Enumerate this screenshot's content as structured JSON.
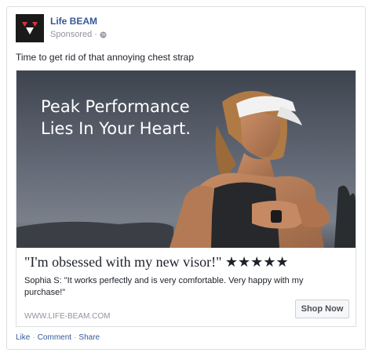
{
  "post": {
    "page_name": "Life BEAM",
    "sponsored": "Sponsored",
    "dot": "·",
    "text": "Time to get rid of that annoying chest strap"
  },
  "ad": {
    "headline_line1": "Peak Performance",
    "headline_line2": "Lies In Your Heart.",
    "quote": "\"I'm obsessed with my new visor!\" ★★★★★",
    "review": "Sophia S: \"It works perfectly and is very comfortable. Very happy with my purchase!\"",
    "url": "WWW.LIFE-BEAM.COM",
    "cta": "Shop Now"
  },
  "actions": {
    "like": "Like",
    "comment": "Comment",
    "share": "Share",
    "sep": "·"
  },
  "icons": {
    "logo": "life-beam-logo-icon",
    "privacy": "globe-icon"
  },
  "colors": {
    "link": "#365899",
    "text": "#1d2129",
    "muted": "#90949c",
    "logo_bg": "#1a1a1a",
    "logo_red": "#e0303a"
  }
}
